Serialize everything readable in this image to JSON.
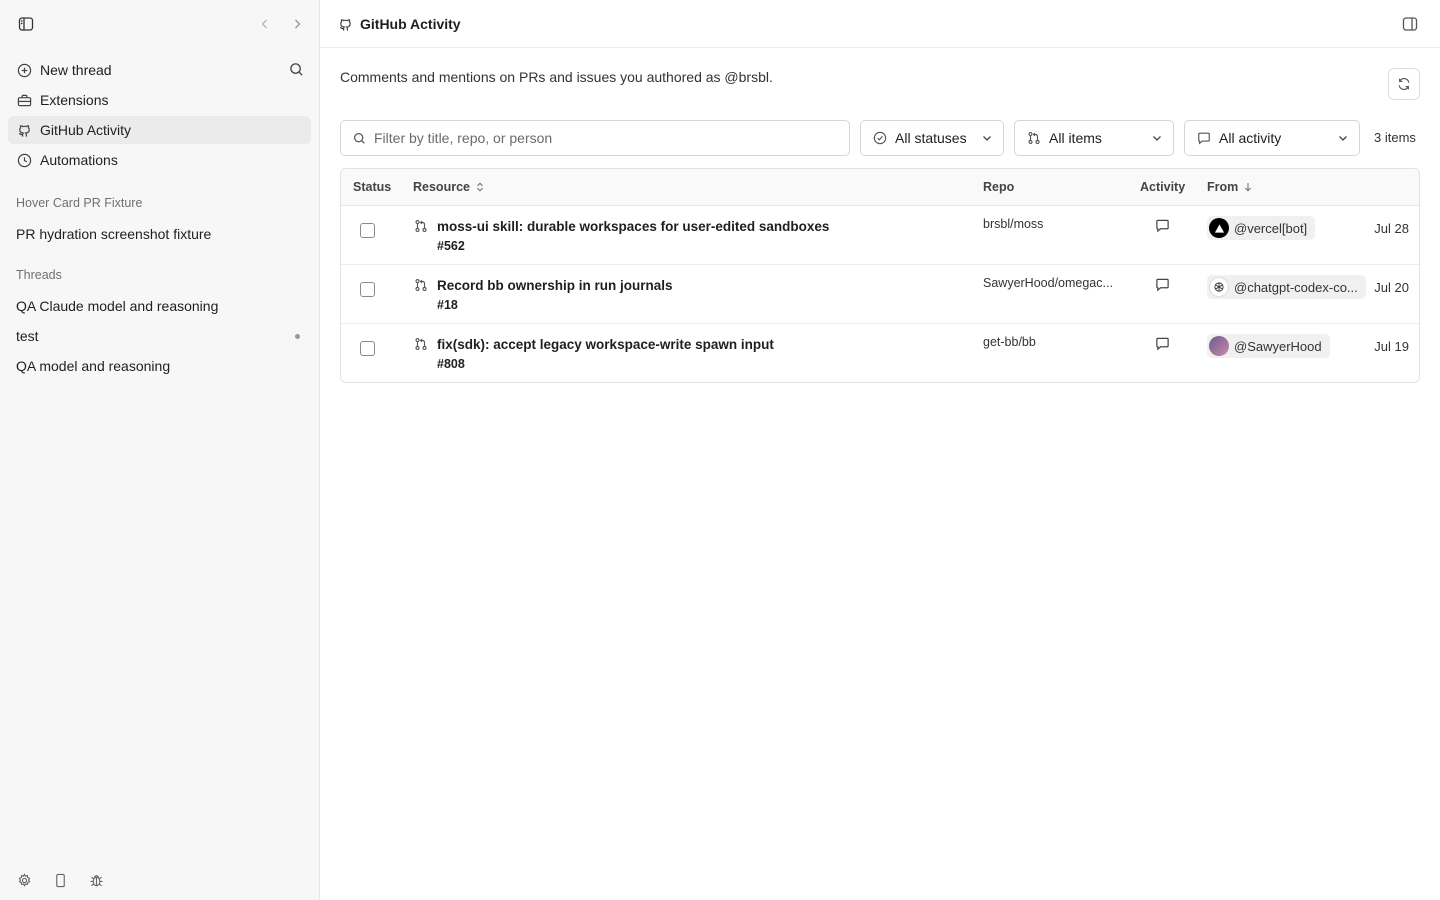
{
  "sidebar": {
    "nav": [
      {
        "label": "New thread",
        "icon": "plus-circle-icon"
      },
      {
        "label": "Extensions",
        "icon": "toolbox-icon"
      },
      {
        "label": "GitHub Activity",
        "icon": "github-icon",
        "active": true
      },
      {
        "label": "Automations",
        "icon": "clock-icon"
      }
    ],
    "pinned": {
      "section": "Hover Card PR Fixture",
      "item": "PR hydration screenshot fixture"
    },
    "threads": {
      "section": "Threads",
      "items": [
        {
          "label": "QA Claude model and reasoning"
        },
        {
          "label": "test",
          "unread": true
        },
        {
          "label": "QA model and reasoning"
        }
      ]
    }
  },
  "header": {
    "title": "GitHub Activity"
  },
  "page": {
    "description": "Comments and mentions on PRs and issues you authored as @brsbl."
  },
  "filters": {
    "search_placeholder": "Filter by title, repo, or person",
    "status": "All statuses",
    "items": "All items",
    "activity": "All activity",
    "count": "3 items"
  },
  "table": {
    "columns": {
      "status": "Status",
      "resource": "Resource",
      "repo": "Repo",
      "activity": "Activity",
      "from": "From"
    },
    "rows": [
      {
        "title": "moss-ui skill: durable workspaces for user-edited sandboxes",
        "number": "#562",
        "repo": "brsbl/moss",
        "from": "@vercel[bot]",
        "date": "Jul 28"
      },
      {
        "title": "Record bb ownership in run journals",
        "number": "#18",
        "repo": "SawyerHood/omegac...",
        "from": "@chatgpt-codex-co...",
        "date": "Jul 20"
      },
      {
        "title": "fix(sdk): accept legacy workspace-write spawn input",
        "number": "#808",
        "repo": "get-bb/bb",
        "from": "@SawyerHood",
        "date": "Jul 19"
      }
    ]
  }
}
